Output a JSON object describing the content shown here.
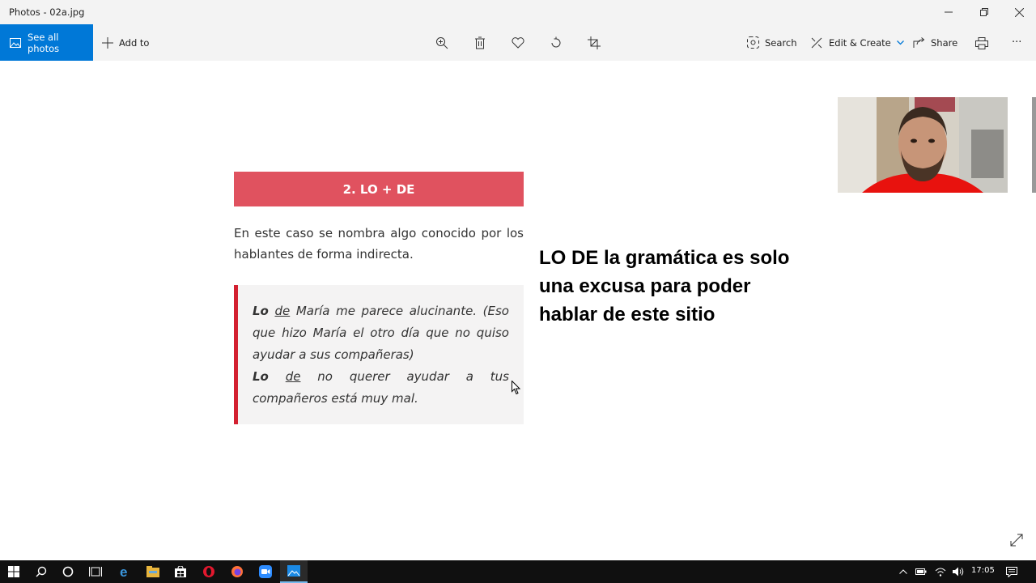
{
  "window": {
    "title": "Photos - 02a.jpg"
  },
  "toolbar": {
    "see_all": "See all photos",
    "add_to": "Add to",
    "search": "Search",
    "edit_create": "Edit & Create",
    "share": "Share",
    "more": "···"
  },
  "slide": {
    "heading": "2. LO + DE",
    "paragraph": "En este caso se nombra algo conocido por los hablantes de forma indirecta.",
    "quote": {
      "ex1_lo": "Lo",
      "ex1_de": "de",
      "ex1_rest": " María me parece alucinante. (Eso que hizo María el otro día que no quiso ayudar a sus compañeras)",
      "ex2_lo": "Lo",
      "ex2_de": "de",
      "ex2_rest": " no querer ayudar a tus compañeros está muy mal."
    },
    "caption": "LO DE la gramática es solo una excusa para poder hablar de este sitio"
  },
  "taskbar": {
    "time": "17:05"
  },
  "colors": {
    "accent": "#0078d7",
    "heading_bg": "#e0525f",
    "quote_border": "#d32030"
  }
}
